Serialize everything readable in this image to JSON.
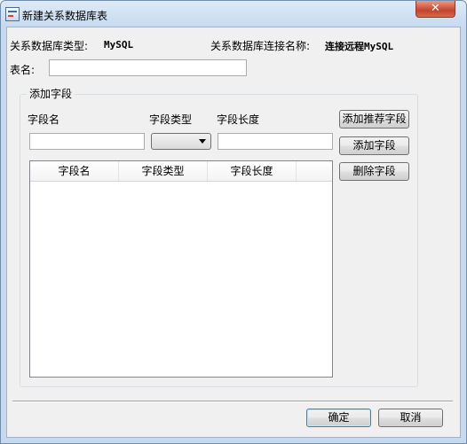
{
  "window": {
    "title": "新建关系数据库表",
    "close_label": "✕"
  },
  "info": {
    "db_type_label": "关系数据库类型:",
    "db_type_value": "MySQL",
    "conn_label": "关系数据库连接名称:",
    "conn_value": "连接远程MySQL"
  },
  "table_name": {
    "label": "表名:",
    "value": ""
  },
  "fields_group": {
    "legend": "添加字段",
    "field_name_label": "字段名",
    "field_type_label": "字段类型",
    "field_length_label": "字段长度",
    "field_name_value": "",
    "field_type_value": "",
    "field_length_value": "",
    "buttons": {
      "add_recommended": "添加推荐字段",
      "add": "添加字段",
      "delete": "删除字段"
    },
    "table": {
      "columns": [
        "字段名",
        "字段类型",
        "字段长度"
      ],
      "rows": []
    }
  },
  "footer": {
    "ok": "确定",
    "cancel": "取消"
  }
}
